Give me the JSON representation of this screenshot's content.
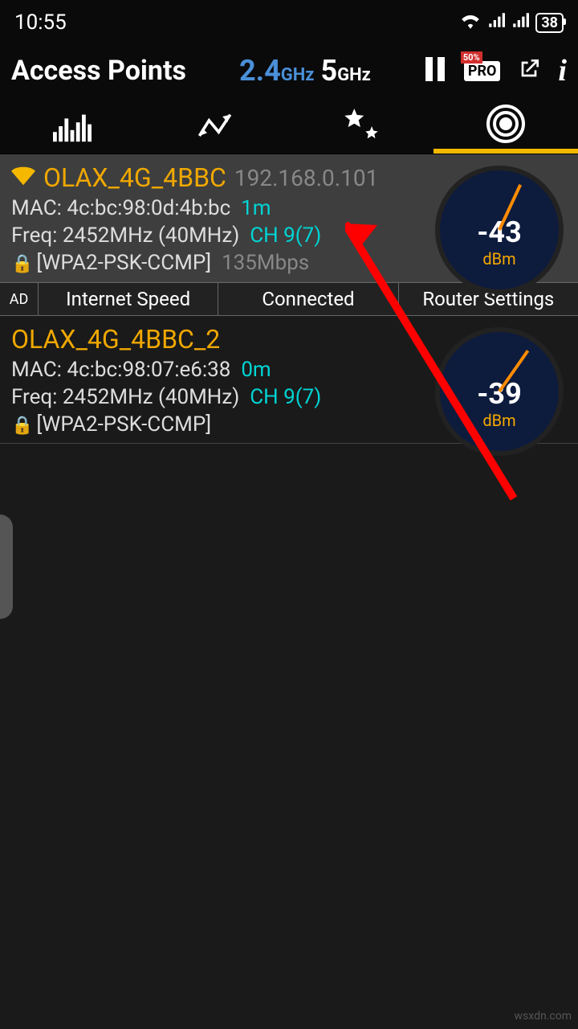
{
  "status": {
    "time": "10:55",
    "battery": "38"
  },
  "header": {
    "title": "Access Points",
    "band24_num": "2.4",
    "band24_unit": "GHz",
    "band5_num": "5",
    "band5_unit": "GHz",
    "pro_label": "PRO",
    "pro_sale": "50%"
  },
  "ad_row": {
    "tag": "AD",
    "c1": "Internet Speed",
    "c2": "Connected",
    "c3": "Router Settings"
  },
  "aps": [
    {
      "ssid": "OLAX_4G_4BBC",
      "ip": "192.168.0.101",
      "mac_label": "MAC: 4c:bc:98:0d:4b:bc",
      "dist": "1m",
      "freq": "Freq: 2452MHz  (40MHz)",
      "ch": "CH 9(7)",
      "sec": "[WPA2-PSK-CCMP]",
      "rate": "135Mbps",
      "signal": "-43",
      "unit": "dBm",
      "needle_deg": 25
    },
    {
      "ssid": "OLAX_4G_4BBC_2",
      "ip": "",
      "mac_label": "MAC: 4c:bc:98:07:e6:38",
      "dist": "0m",
      "freq": "Freq: 2452MHz  (40MHz)",
      "ch": "CH 9(7)",
      "sec": "[WPA2-PSK-CCMP]",
      "rate": "",
      "signal": "-39",
      "unit": "dBm",
      "needle_deg": 35
    }
  ],
  "watermark": "wsxdn.com"
}
